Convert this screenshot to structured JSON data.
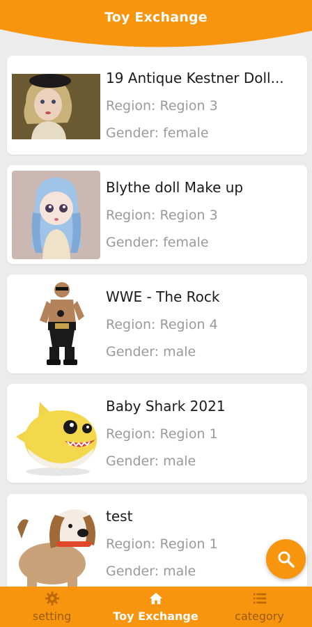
{
  "app": {
    "title": "Toy Exchange",
    "accent_color": "#f7950f"
  },
  "toys": [
    {
      "title": "19 Antique Kestner Doll...",
      "region": "Region: Region 3",
      "gender": "Gender: female",
      "image": "antique-doll-image"
    },
    {
      "title": "Blythe doll Make up",
      "region": "Region: Region 3",
      "gender": "Gender: female",
      "image": "blythe-doll-image"
    },
    {
      "title": "WWE - The Rock",
      "region": "Region: Region 4",
      "gender": "Gender: male",
      "image": "wrestler-figure-image"
    },
    {
      "title": "Baby Shark 2021",
      "region": "Region: Region 1",
      "gender": "Gender: male",
      "image": "baby-shark-plush-image"
    },
    {
      "title": "test",
      "region": "Region: Region 1",
      "gender": "Gender: male",
      "image": "puppy-toy-image"
    }
  ],
  "fab": {
    "icon": "search-icon"
  },
  "tabbar": {
    "tabs": [
      {
        "label": "setting",
        "icon": "gear-icon",
        "active": false
      },
      {
        "label": "Toy Exchange",
        "icon": "home-icon",
        "active": true
      },
      {
        "label": "category",
        "icon": "list-icon",
        "active": false
      }
    ]
  }
}
